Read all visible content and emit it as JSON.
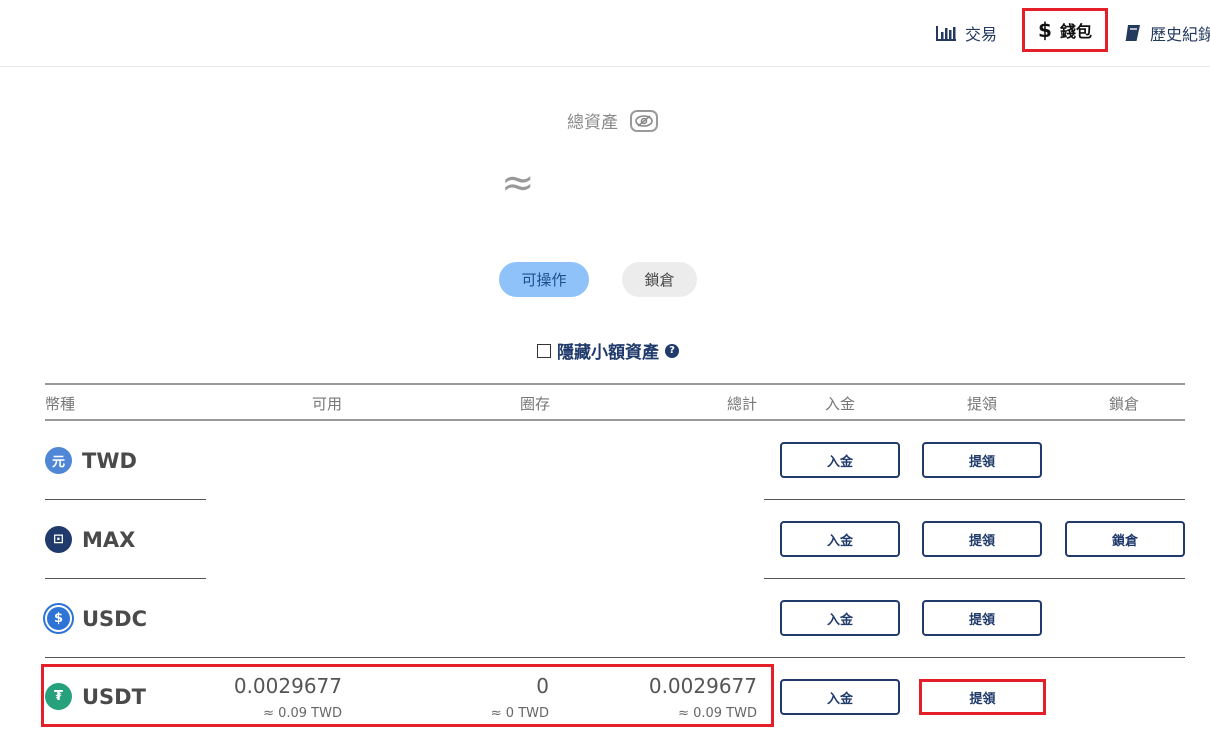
{
  "nav": {
    "trade_label": "交易",
    "wallet_symbol": "$",
    "wallet_label": "錢包",
    "history_label": "歷史紀錄"
  },
  "summary": {
    "total_label": "總資產",
    "total_value": "≈"
  },
  "filters": {
    "active_label": "可操作",
    "locked_label": "鎖倉"
  },
  "hide_small_label": "隱藏小額資產",
  "table": {
    "headers": [
      "幣種",
      "可用",
      "圈存",
      "總計",
      "入金",
      "提領",
      "鎖倉"
    ],
    "rows": [
      {
        "coin": "TWD",
        "icon_text": "元",
        "deposit": "入金",
        "withdraw": "提領"
      },
      {
        "coin": "MAX",
        "icon_text": "⊡",
        "deposit": "入金",
        "withdraw": "提領",
        "lock": "鎖倉"
      },
      {
        "coin": "USDC",
        "icon_text": "$",
        "deposit": "入金",
        "withdraw": "提領"
      },
      {
        "coin": "USDT",
        "icon_text": "₮",
        "available": "0.0029677",
        "available_twd": "≈ 0.09 TWD",
        "locked": "0",
        "locked_twd": "≈ 0 TWD",
        "total": "0.0029677",
        "total_twd": "≈ 0.09 TWD",
        "deposit": "入金",
        "withdraw": "提領"
      }
    ]
  },
  "colors": {
    "navy": "#1f3a6b",
    "highlight": "#e3202a",
    "active_pill": "#8ec2f8"
  }
}
